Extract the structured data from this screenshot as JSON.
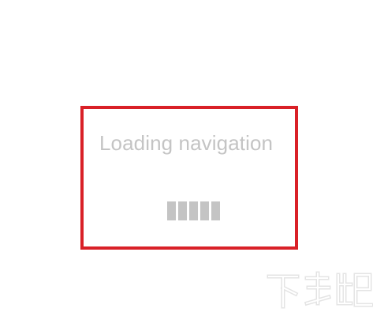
{
  "loading": {
    "message": "Loading navigation",
    "indicator_blocks": 5
  },
  "highlight": {
    "color": "#d92027"
  },
  "watermark": {
    "text": "下载吧"
  },
  "colors": {
    "text": "#c4c4c4",
    "blocks": "#c4c4c4",
    "background": "#ffffff"
  }
}
